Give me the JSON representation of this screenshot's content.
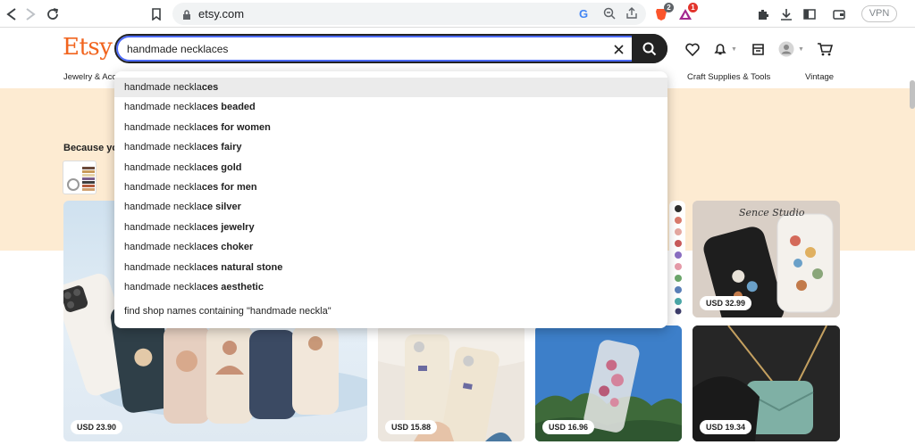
{
  "browser": {
    "url": "etsy.com",
    "vpn_label": "VPN",
    "brave_badge": "2",
    "rewards_badge": "1"
  },
  "header": {
    "logo": "Etsy",
    "search_value": "handmade necklaces"
  },
  "nav": {
    "items": [
      "Jewelry & Acc",
      "Craft Supplies & Tools",
      "Vintage"
    ]
  },
  "because_label": "Because yo",
  "suggestions": {
    "items": [
      {
        "typed": "handmade neckla",
        "completion": "ces"
      },
      {
        "typed": "handmade neckla",
        "completion": "ces beaded"
      },
      {
        "typed": "handmade neckla",
        "completion": "ces for women"
      },
      {
        "typed": "handmade neckla",
        "completion": "ces fairy"
      },
      {
        "typed": "handmade neckla",
        "completion": "ces gold"
      },
      {
        "typed": "handmade neckla",
        "completion": "ces for men"
      },
      {
        "typed": "handmade neckla",
        "completion": "ce silver"
      },
      {
        "typed": "handmade neckla",
        "completion": "ces jewelry"
      },
      {
        "typed": "handmade neckla",
        "completion": "ces choker"
      },
      {
        "typed": "handmade neckla",
        "completion": "ces natural stone"
      },
      {
        "typed": "handmade neckla",
        "completion": "ces aesthetic"
      }
    ],
    "shop_search": "find shop names containing \"handmade neckla\""
  },
  "products": [
    {
      "price": "USD 23.90"
    },
    {
      "price": "USD 32.99"
    },
    {
      "price": "USD 15.88"
    },
    {
      "price": "USD 16.96"
    },
    {
      "price": "USD 19.34"
    }
  ],
  "colors": {
    "brand": "#f1641e",
    "banner": "#fdebd2",
    "highlight": "#ebebeb"
  }
}
